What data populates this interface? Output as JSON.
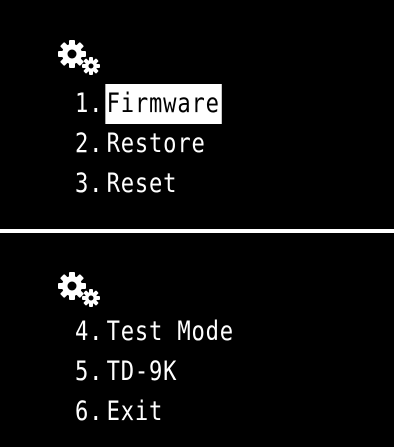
{
  "colors": {
    "background": "#000000",
    "text": "#ffffff",
    "selection_background": "#ffffff",
    "selection_text": "#000000",
    "divider": "#ffffff"
  },
  "screens": [
    {
      "icon": "gears-icon",
      "items": [
        {
          "number": "1.",
          "label": "Firmware",
          "selected": true
        },
        {
          "number": "2.",
          "label": "Restore",
          "selected": false
        },
        {
          "number": "3.",
          "label": "Reset",
          "selected": false
        }
      ]
    },
    {
      "icon": "gears-icon",
      "items": [
        {
          "number": "4.",
          "label": "Test Mode",
          "selected": false
        },
        {
          "number": "5.",
          "label": "TD-9K",
          "selected": false
        },
        {
          "number": "6.",
          "label": "Exit",
          "selected": false
        }
      ]
    }
  ]
}
